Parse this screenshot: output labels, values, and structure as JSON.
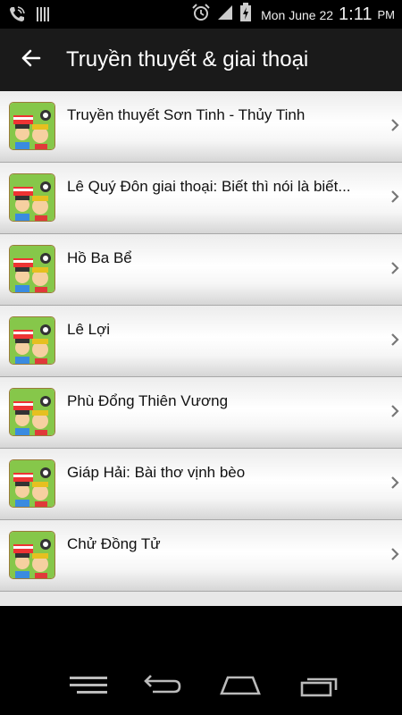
{
  "status_bar": {
    "date": "Mon June 22",
    "time": "1:11",
    "ampm": "PM",
    "icons": [
      "phone-call-icon",
      "signal-bars-icon",
      "alarm-icon",
      "cell-signal-icon",
      "battery-charging-icon"
    ]
  },
  "action_bar": {
    "title": "Truyền thuyết & giai thoại",
    "back_icon": "arrow-left-icon"
  },
  "list": {
    "items": [
      {
        "title": "Truyền thuyết Sơn Tinh - Thủy Tinh"
      },
      {
        "title": "Lê Quý Đôn giai thoại: Biết thì nói là biết..."
      },
      {
        "title": "Hồ Ba Bể"
      },
      {
        "title": "Lê Lợi"
      },
      {
        "title": "Phù Đổng Thiên Vương"
      },
      {
        "title": "Giáp Hải: Bài thơ vịnh bèo"
      },
      {
        "title": "Chử Đồng Tử"
      }
    ]
  },
  "nav_bar": {
    "icons": [
      "menu-icon",
      "back-icon",
      "home-icon",
      "recent-apps-icon"
    ]
  },
  "colors": {
    "action_bar": "#1a1a1a",
    "list_bg": "#e8e8e8",
    "thumb_green": "#7fc241"
  }
}
